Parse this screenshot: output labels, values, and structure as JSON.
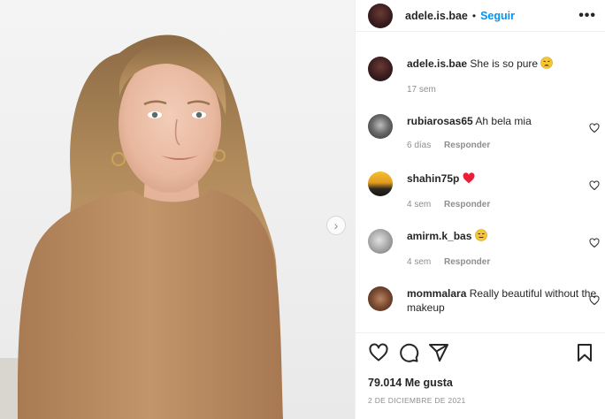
{
  "post": {
    "author": "adele.is.bae",
    "follow_label": "Seguir",
    "separator": "•",
    "more_label": "•••",
    "next_arrow": "›"
  },
  "caption": {
    "user": "adele.is.bae",
    "text": "She is so pure",
    "emoji": "weary-face",
    "time": "17 sem"
  },
  "comments": [
    {
      "user": "rubiarosas65",
      "text": "Ah bela mia",
      "time": "6 días",
      "reply_label": "Responder",
      "emoji": ""
    },
    {
      "user": "shahin75p",
      "text": "",
      "time": "4 sem",
      "reply_label": "Responder",
      "emoji": "red-heart"
    },
    {
      "user": "amirm.k_bas",
      "text": "",
      "time": "4 sem",
      "reply_label": "Responder",
      "emoji": "expressionless-face"
    },
    {
      "user": "mommalara",
      "text": "Really beautiful without the makeup",
      "time": "",
      "reply_label": "",
      "emoji": ""
    }
  ],
  "actions": {
    "icons": [
      "heart-icon",
      "comment-icon",
      "share-icon",
      "bookmark-icon"
    ]
  },
  "likes_text": "79.014 Me gusta",
  "date_text": "2 DE DICIEMBRE DE 2021",
  "colors": {
    "follow": "#0095f6",
    "text": "#262626",
    "muted": "#8e8e8e",
    "heart_emoji": "#ed1c3a",
    "sweater": "#b98c62"
  }
}
